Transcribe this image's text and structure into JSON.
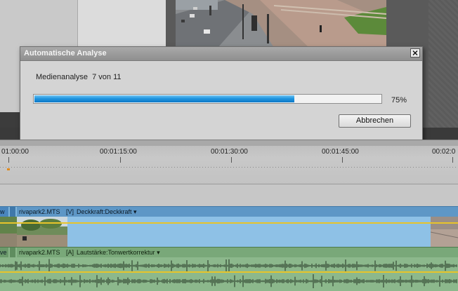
{
  "dialog": {
    "title": "Automatische Analyse",
    "status": "Medienanalyse  7 von 11",
    "progress_percent": "75%",
    "progress_fraction": 0.75,
    "cancel_label": "Abbrechen"
  },
  "timeline": {
    "timecodes": [
      "01:00:00",
      "00:01:15:00",
      "00:01:30:00",
      "00:01:45:00",
      "00:02:0"
    ],
    "video_clip": {
      "name": "rivapark2.MTS",
      "track_tag": "[V]",
      "effect": "Deckkraft:Deckkraft",
      "edge_label": "w"
    },
    "audio_clip": {
      "name": "rivapark2.MTS",
      "track_tag": "[A]",
      "effect": "Lautstärke:Tonwertkorrektur",
      "edge_label": "ve"
    }
  },
  "colors": {
    "progress_blue": "#1f8fdc",
    "video_track": "#7fb5dc",
    "audio_track": "#8cb88c",
    "level_line": "#e8c42a",
    "playhead": "#e08a1e"
  }
}
